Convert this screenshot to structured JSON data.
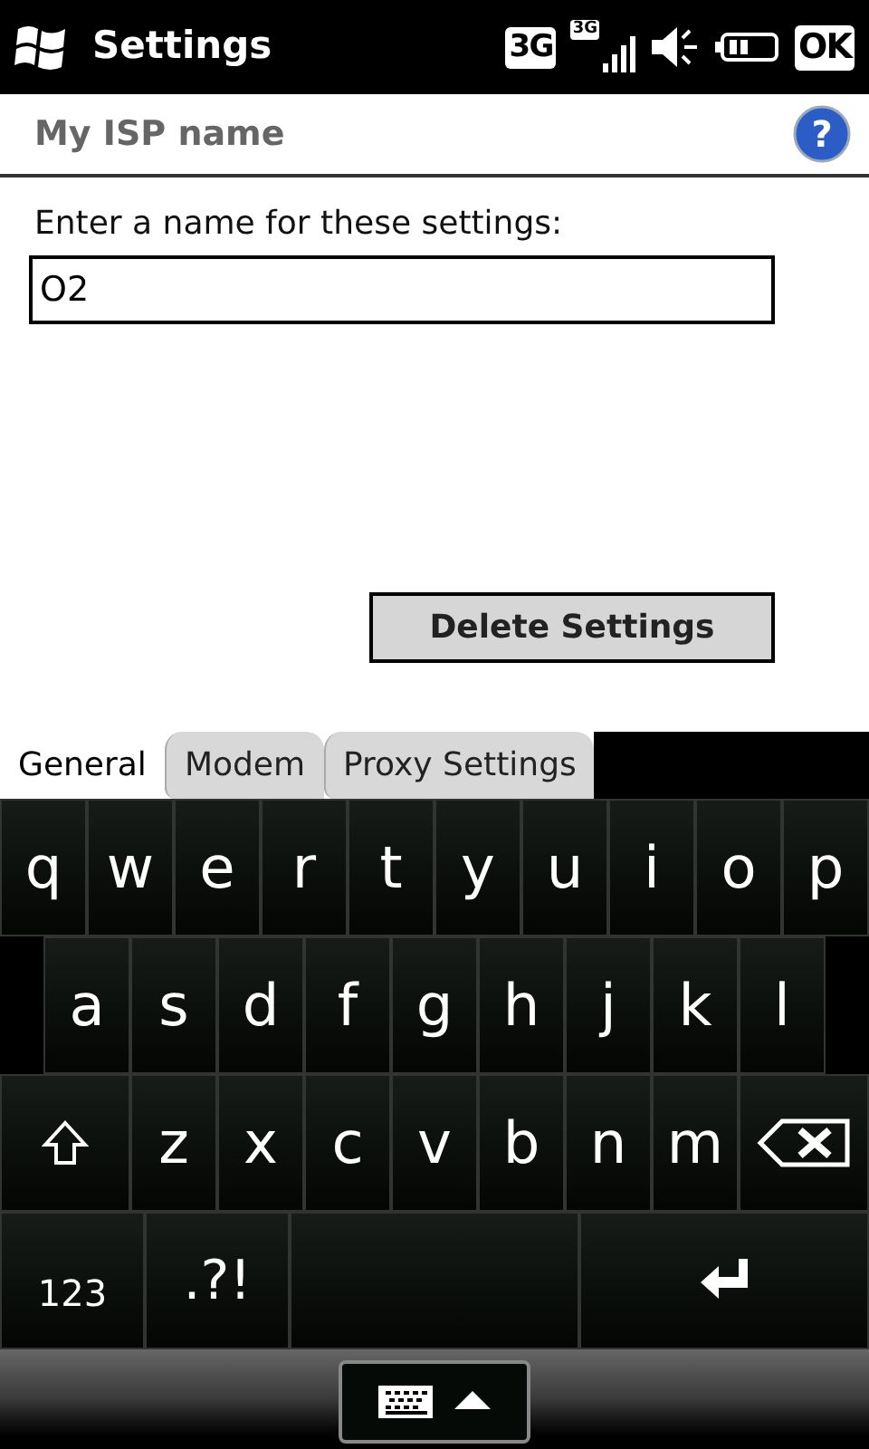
{
  "status_bar": {
    "title": "Settings",
    "network": "3G",
    "signal_network": "3G",
    "ok": "OK"
  },
  "header": {
    "title": "My ISP name",
    "help": "?"
  },
  "form": {
    "label": "Enter a name for these settings:",
    "value": "O2",
    "button": "Delete Settings"
  },
  "tabs": [
    {
      "label": "General",
      "selected": true
    },
    {
      "label": "Modem",
      "selected": false
    },
    {
      "label": "Proxy Settings",
      "selected": false
    }
  ],
  "keyboard": {
    "rows": [
      [
        {
          "kind": "char",
          "label": "q"
        },
        {
          "kind": "char",
          "label": "w"
        },
        {
          "kind": "char",
          "label": "e"
        },
        {
          "kind": "char",
          "label": "r"
        },
        {
          "kind": "char",
          "label": "t"
        },
        {
          "kind": "char",
          "label": "y"
        },
        {
          "kind": "char",
          "label": "u"
        },
        {
          "kind": "char",
          "label": "i"
        },
        {
          "kind": "char",
          "label": "o"
        },
        {
          "kind": "char",
          "label": "p"
        }
      ],
      [
        {
          "kind": "char",
          "label": "a"
        },
        {
          "kind": "char",
          "label": "s"
        },
        {
          "kind": "char",
          "label": "d"
        },
        {
          "kind": "char",
          "label": "f"
        },
        {
          "kind": "char",
          "label": "g"
        },
        {
          "kind": "char",
          "label": "h"
        },
        {
          "kind": "char",
          "label": "j"
        },
        {
          "kind": "char",
          "label": "k"
        },
        {
          "kind": "char",
          "label": "l"
        }
      ],
      [
        {
          "kind": "shift"
        },
        {
          "kind": "char",
          "label": "z"
        },
        {
          "kind": "char",
          "label": "x"
        },
        {
          "kind": "char",
          "label": "c"
        },
        {
          "kind": "char",
          "label": "v"
        },
        {
          "kind": "char",
          "label": "b"
        },
        {
          "kind": "char",
          "label": "n"
        },
        {
          "kind": "char",
          "label": "m"
        },
        {
          "kind": "backspace"
        }
      ],
      [
        {
          "kind": "symbols",
          "label": "123"
        },
        {
          "kind": "punct",
          "label": ".?!"
        },
        {
          "kind": "space"
        },
        {
          "kind": "enter"
        }
      ]
    ]
  }
}
